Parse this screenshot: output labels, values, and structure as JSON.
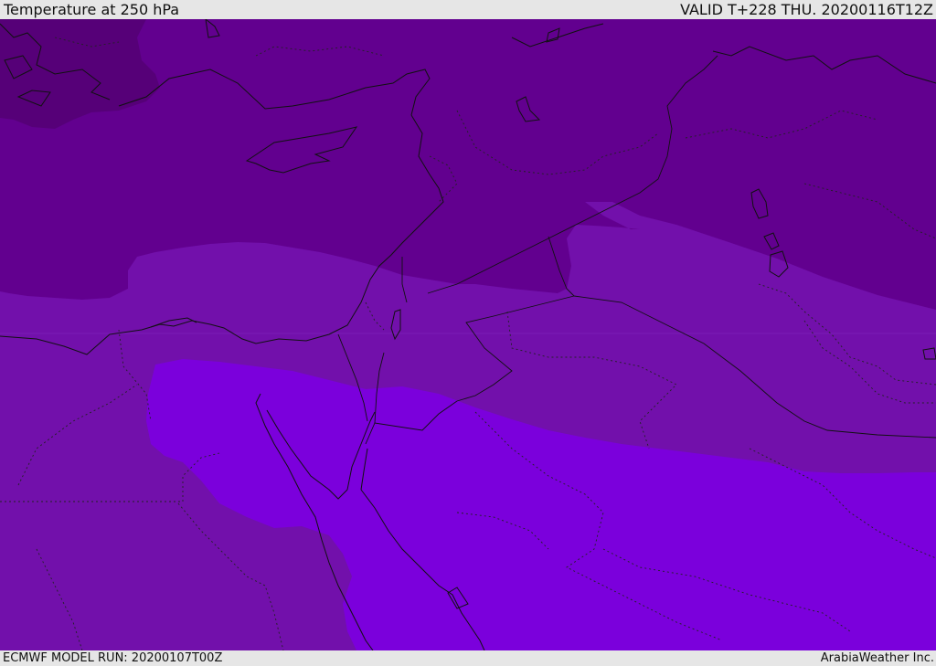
{
  "header": {
    "title": "Temperature at 250 hPa",
    "valid": "VALID T+228 THU. 20200116T12Z"
  },
  "footer": {
    "model_run": "ECMWF MODEL RUN: 20200107T00Z",
    "credit": "ArabiaWeather Inc."
  },
  "map": {
    "colors": {
      "darkest": "#560078",
      "dark": "#62008f",
      "medium": "#7210ab",
      "bright": "#7b00dc",
      "border": "#111111"
    }
  }
}
